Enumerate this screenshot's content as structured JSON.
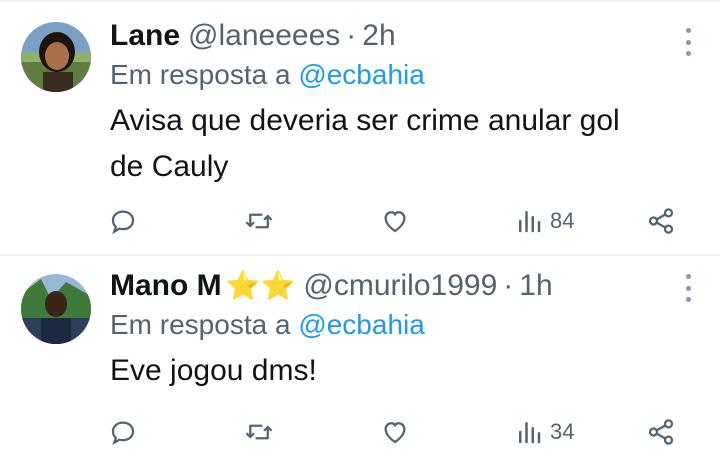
{
  "tweets": [
    {
      "name": "Lane",
      "stars": "",
      "handle": "@laneeees",
      "separator": "·",
      "time": "2h",
      "reply_prefix": "Em resposta a",
      "reply_to": "@ecbahia",
      "text_line1": "Avisa que deveria ser crime anular gol",
      "text_line2": "de Cauly",
      "views": "84"
    },
    {
      "name": "Mano M",
      "stars": "⭐⭐",
      "handle": "@cmurilo1999",
      "separator": "·",
      "time": "1h",
      "reply_prefix": "Em resposta a",
      "reply_to": "@ecbahia",
      "text_line1": "Eve jogou dms!",
      "text_line2": "",
      "views": "34"
    }
  ],
  "icons": {
    "reply": "reply-icon",
    "retweet": "retweet-icon",
    "like": "heart-icon",
    "views": "views-icon",
    "share": "share-icon",
    "more": "more-icon"
  },
  "colors": {
    "mention": "#1d9bf0",
    "secondary": "#536471",
    "star": "#f5c518"
  }
}
